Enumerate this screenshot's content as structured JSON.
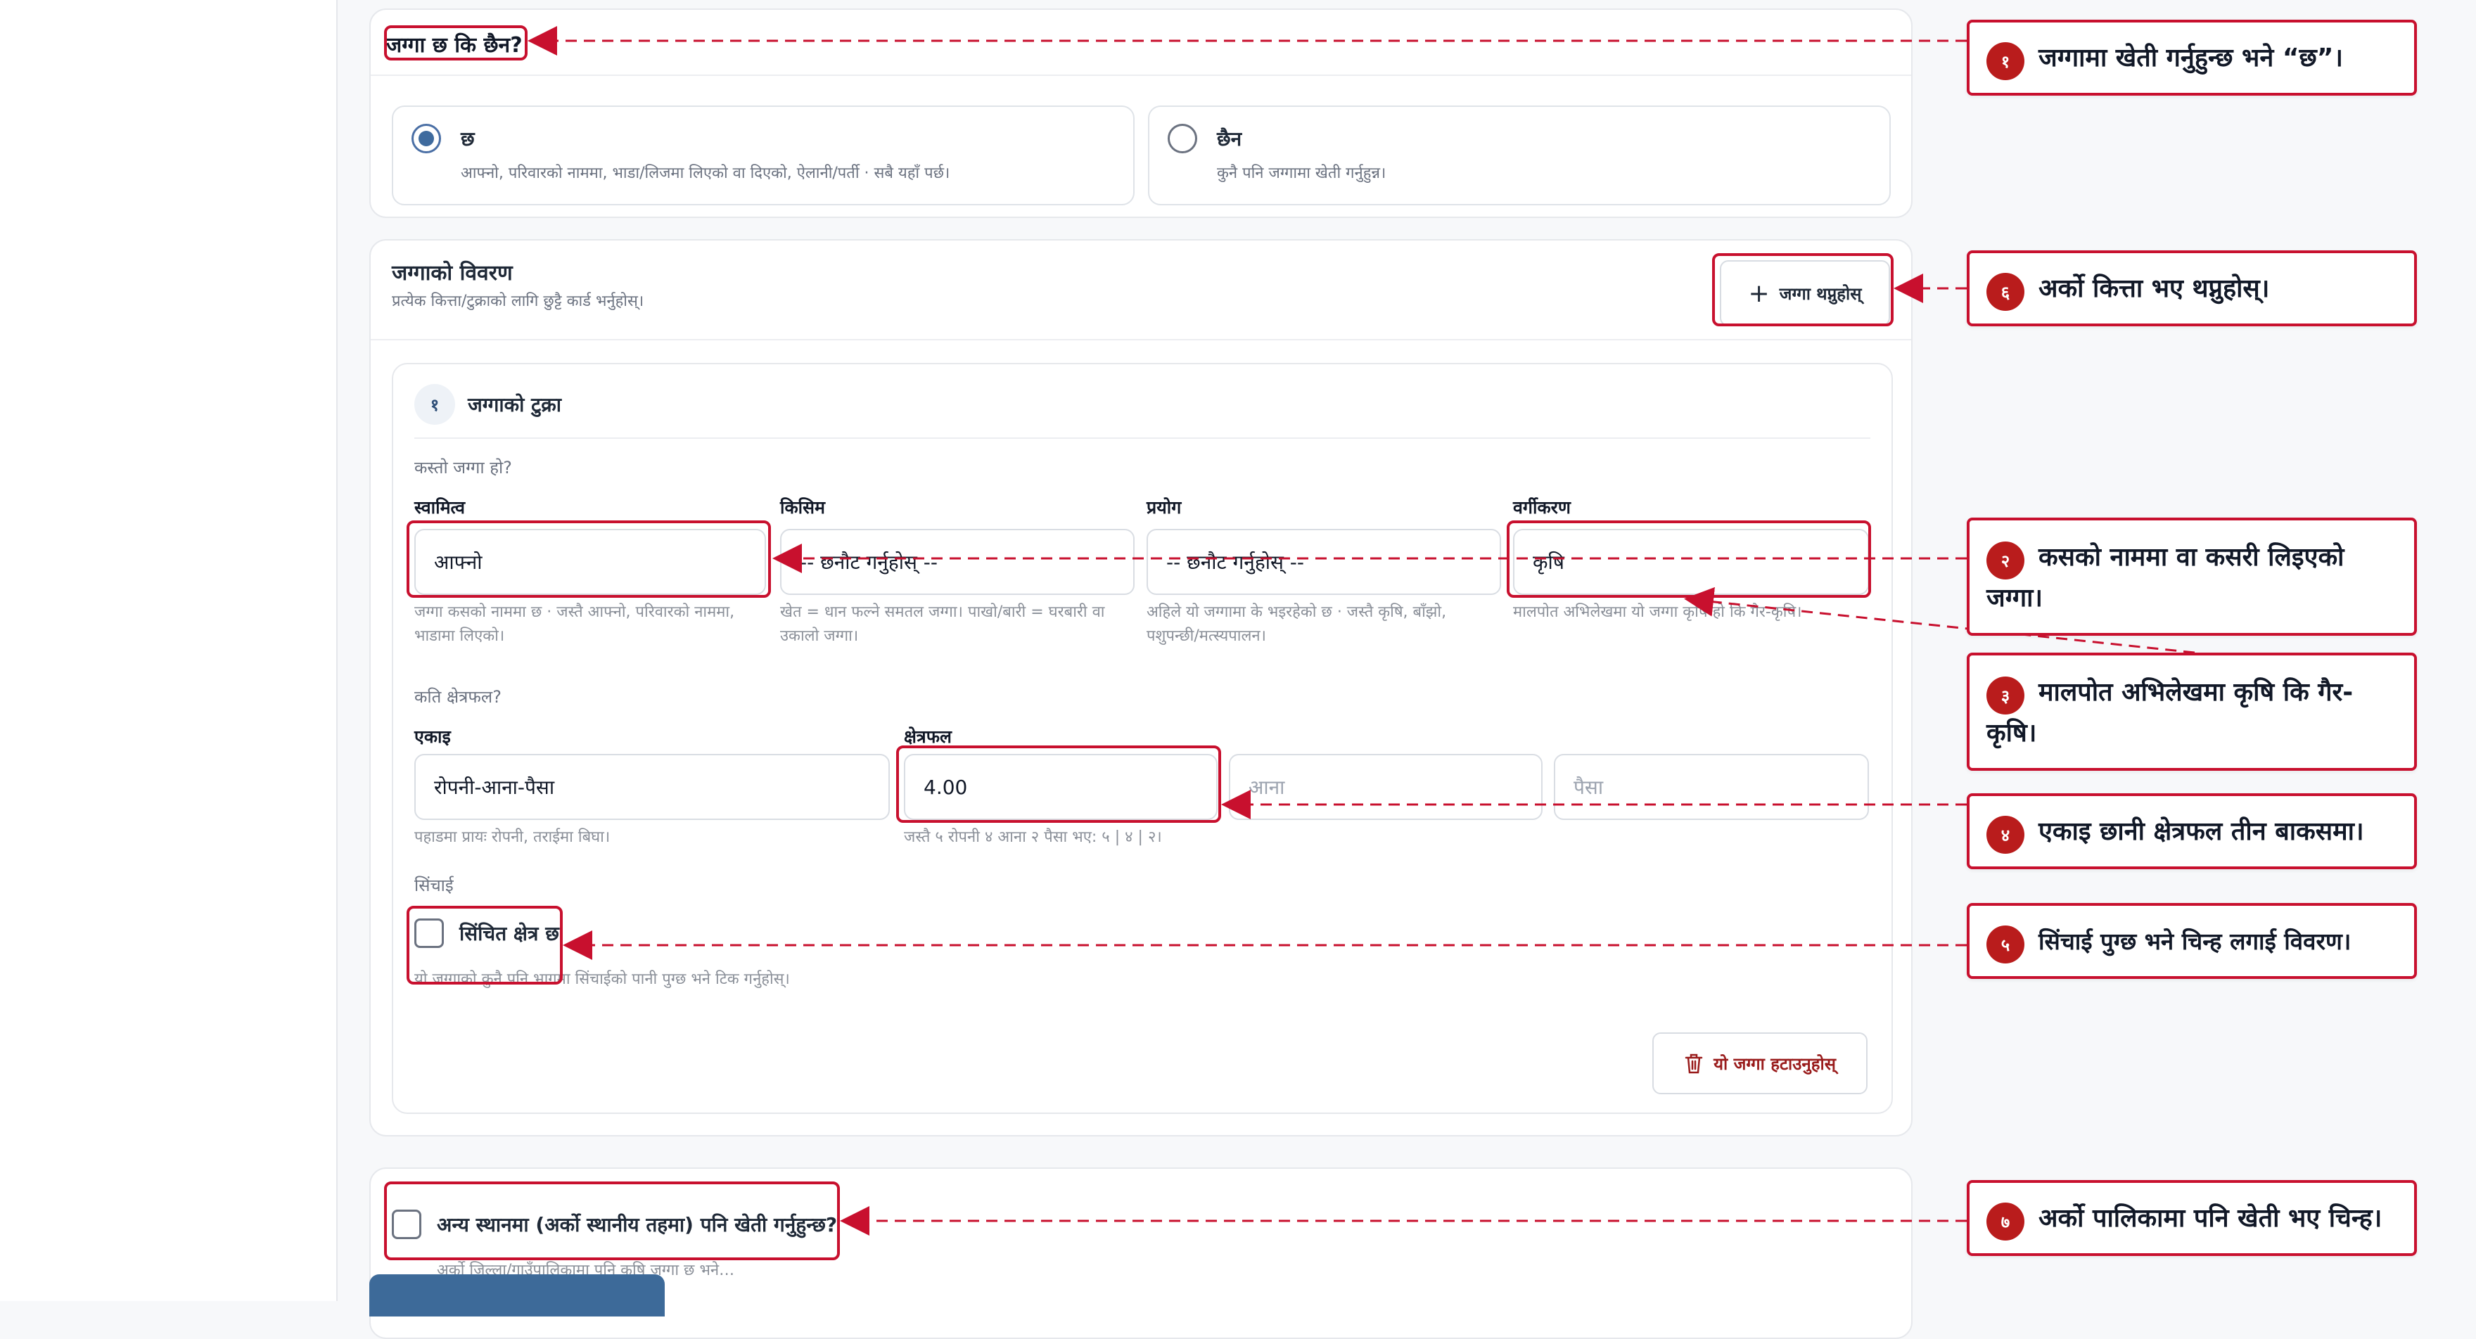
{
  "land_question": {
    "title": "जग्गा छ कि छैन?",
    "options": [
      {
        "label": "छ",
        "help": "आफ्नो, परिवारको नाममा, भाडा/लिजमा लिएको वा दिएको, ऐलानी/पर्ती · सबै यहाँ पर्छ।",
        "selected": true
      },
      {
        "label": "छैन",
        "help": "कुनै पनि जग्गामा खेती गर्नुहुन्न।",
        "selected": false
      }
    ]
  },
  "land_details": {
    "title": "जग्गाको विवरण",
    "subtitle": "प्रत्येक कित्ता/टुक्राको लागि छुट्टै कार्ड भर्नुहोस्।",
    "add_button": "जग्गा थप्नुहोस्",
    "parcel": {
      "number": "१",
      "title": "जग्गाको टुक्रा",
      "what_land": "कस्तो जग्गा हो?",
      "fields": [
        {
          "label": "स्वामित्व",
          "value": "आफ्नो",
          "help": "जग्गा कसको नाममा छ · जस्तै आफ्नो, परिवारको नाममा, भाडामा लिएको।"
        },
        {
          "label": "किसिम",
          "value": "-- छनौट गर्नुहोस् --",
          "help": "खेत = धान फल्ने समतल जग्गा। पाखो/बारी = घरबारी वा उकालो जग्गा।"
        },
        {
          "label": "प्रयोग",
          "value": "-- छनौट गर्नुहोस् --",
          "help": "अहिले यो जग्गामा के भइरहेको छ · जस्तै कृषि, बाँझो, पशुपन्छी/मत्स्यपालन।"
        },
        {
          "label": "वर्गीकरण",
          "value": "कृषि",
          "help": "मालपोत अभिलेखमा यो जग्गा कृषि हो कि गैर-कृषि।"
        }
      ],
      "area_question": "कति क्षेत्रफल?",
      "unit_label": "एकाइ",
      "unit_value": "रोपनी-आना-पैसा",
      "unit_help": "पहाडमा प्रायः रोपनी, तराईमा बिघा।",
      "area_label": "क्षेत्रफल",
      "area_value": "4.00",
      "area_ph_2": "आना",
      "area_ph_3": "पैसा",
      "area_help": "जस्तै ५ रोपनी ४ आना २ पैसा भए: ५ | ४ | २।",
      "irrigation_q": "सिंचाई",
      "irrigation_label": "सिंचित क्षेत्र छ",
      "irrigation_help": "यो जग्गाको कुनै पनि भागमा सिंचाईको पानी पुग्छ भने टिक गर्नुहोस्।",
      "remove_button": "यो जग्गा हटाउनुहोस्"
    }
  },
  "other_place": {
    "label": "अन्य स्थानमा (अर्को स्थानीय तहमा) पनि खेती गर्नुहुन्छ?",
    "help": "अर्को जिल्ला/गाउँपालिकामा पनि कृषि जग्गा छ भने…"
  },
  "callouts": [
    {
      "num": "१",
      "text": "जग्गामा खेती गर्नुहुन्छ भने “छ”।"
    },
    {
      "num": "६",
      "text": "अर्को कित्ता भए थप्नुहोस्।"
    },
    {
      "num": "२",
      "text": "कसको नाममा वा कसरी लिइएको जग्गा।"
    },
    {
      "num": "३",
      "text": "मालपोत अभिलेखमा कृषि कि गैर-कृषि।"
    },
    {
      "num": "४",
      "text": "एकाइ छानी क्षेत्रफल तीन बाकसमा।"
    },
    {
      "num": "५",
      "text": "सिंचाई पुग्छ भने चिन्ह लगाई विवरण।"
    },
    {
      "num": "७",
      "text": "अर्को पालिकामा पनि खेती भए चिन्ह।"
    }
  ],
  "colors": {
    "accent": "#c8102e",
    "radio": "#3f6b9e",
    "primary_button": "#3d6a99"
  }
}
